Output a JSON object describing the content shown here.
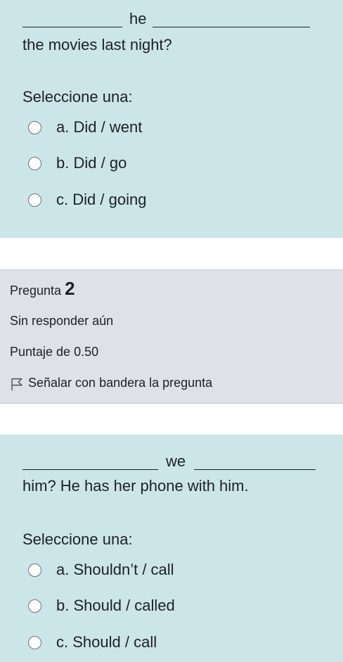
{
  "question1": {
    "prompt_word": "he",
    "prompt_continuation": "the movies last night?",
    "select_label": "Seleccione una:",
    "options": [
      {
        "letter": "a.",
        "text": "Did / went"
      },
      {
        "letter": "b.",
        "text": "Did / go"
      },
      {
        "letter": "c.",
        "text": "Did / going"
      }
    ]
  },
  "info": {
    "pregunta_label": "Pregunta",
    "number": "2",
    "status": "Sin responder aún",
    "score": "Puntaje de 0.50",
    "flag_label": "Señalar con bandera la pregunta"
  },
  "question2": {
    "prompt_word": "we",
    "prompt_continuation": "him? He has her phone with him.",
    "select_label": "Seleccione una:",
    "options": [
      {
        "letter": "a.",
        "text": "Shouldn’t / call"
      },
      {
        "letter": "b.",
        "text": " Should / called"
      },
      {
        "letter": "c.",
        "text": "Should / call"
      }
    ]
  },
  "colors": {
    "question_bg": "#cce5e9",
    "info_bg": "#dee2e6",
    "text": "#1d2125"
  },
  "icons": {
    "flag": "flag-outline-icon",
    "radio": "radio-empty-icon"
  }
}
